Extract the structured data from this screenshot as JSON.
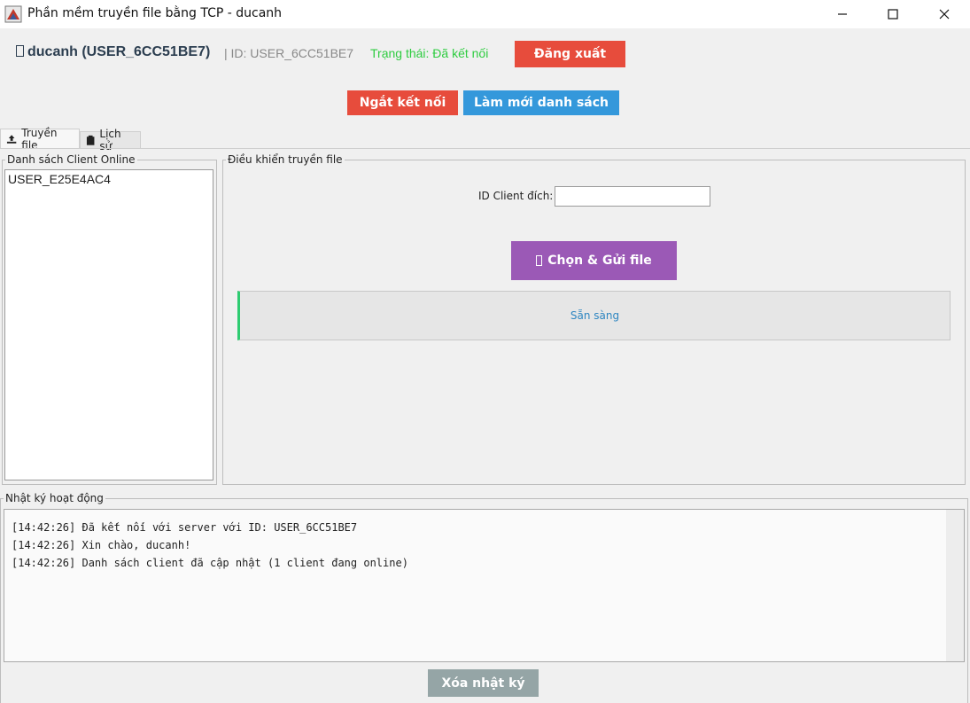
{
  "window": {
    "title": "Phần mềm truyền file bằng TCP - ducanh",
    "controls": {
      "minimize": "minimize-icon",
      "maximize": "maximize-icon",
      "close": "close-icon"
    }
  },
  "header": {
    "user_label": "ducanh (USER_6CC51BE7)",
    "id_label": "| ID: USER_6CC51BE7",
    "status_label": "Trạng thái: Đã kết nối",
    "logout_button": "Đăng xuất"
  },
  "actions": {
    "disconnect_button": "Ngắt kết nối",
    "refresh_button": "Làm mới danh sách"
  },
  "tabs": [
    {
      "label": "Truyền file",
      "icon": "upload-icon",
      "active": true
    },
    {
      "label": "Lịch sử",
      "icon": "clipboard-icon",
      "active": false
    }
  ],
  "client_panel": {
    "title": "Danh sách Client Online",
    "items": [
      "USER_E25E4AC4"
    ]
  },
  "transfer_panel": {
    "title": "Điều khiển truyền file",
    "target_label": "ID Client đích:",
    "target_value": "",
    "send_button": "Chọn & Gửi file",
    "status_text": "Sẵn sàng"
  },
  "log_panel": {
    "title": "Nhật ký hoạt động",
    "lines": [
      "[14:42:26] Đã kết nối với server với ID: USER_6CC51BE7",
      "[14:42:26] Xin chào, ducanh!",
      "[14:42:26] Danh sách client đã cập nhật (1 client đang online)"
    ],
    "clear_button": "Xóa nhật ký"
  },
  "colors": {
    "danger": "#e74c3c",
    "primary": "#3498db",
    "purple": "#9b59b6",
    "gray_button": "#95a5a6",
    "status_green": "#2ecc40",
    "progress_text": "#2e86c1"
  }
}
